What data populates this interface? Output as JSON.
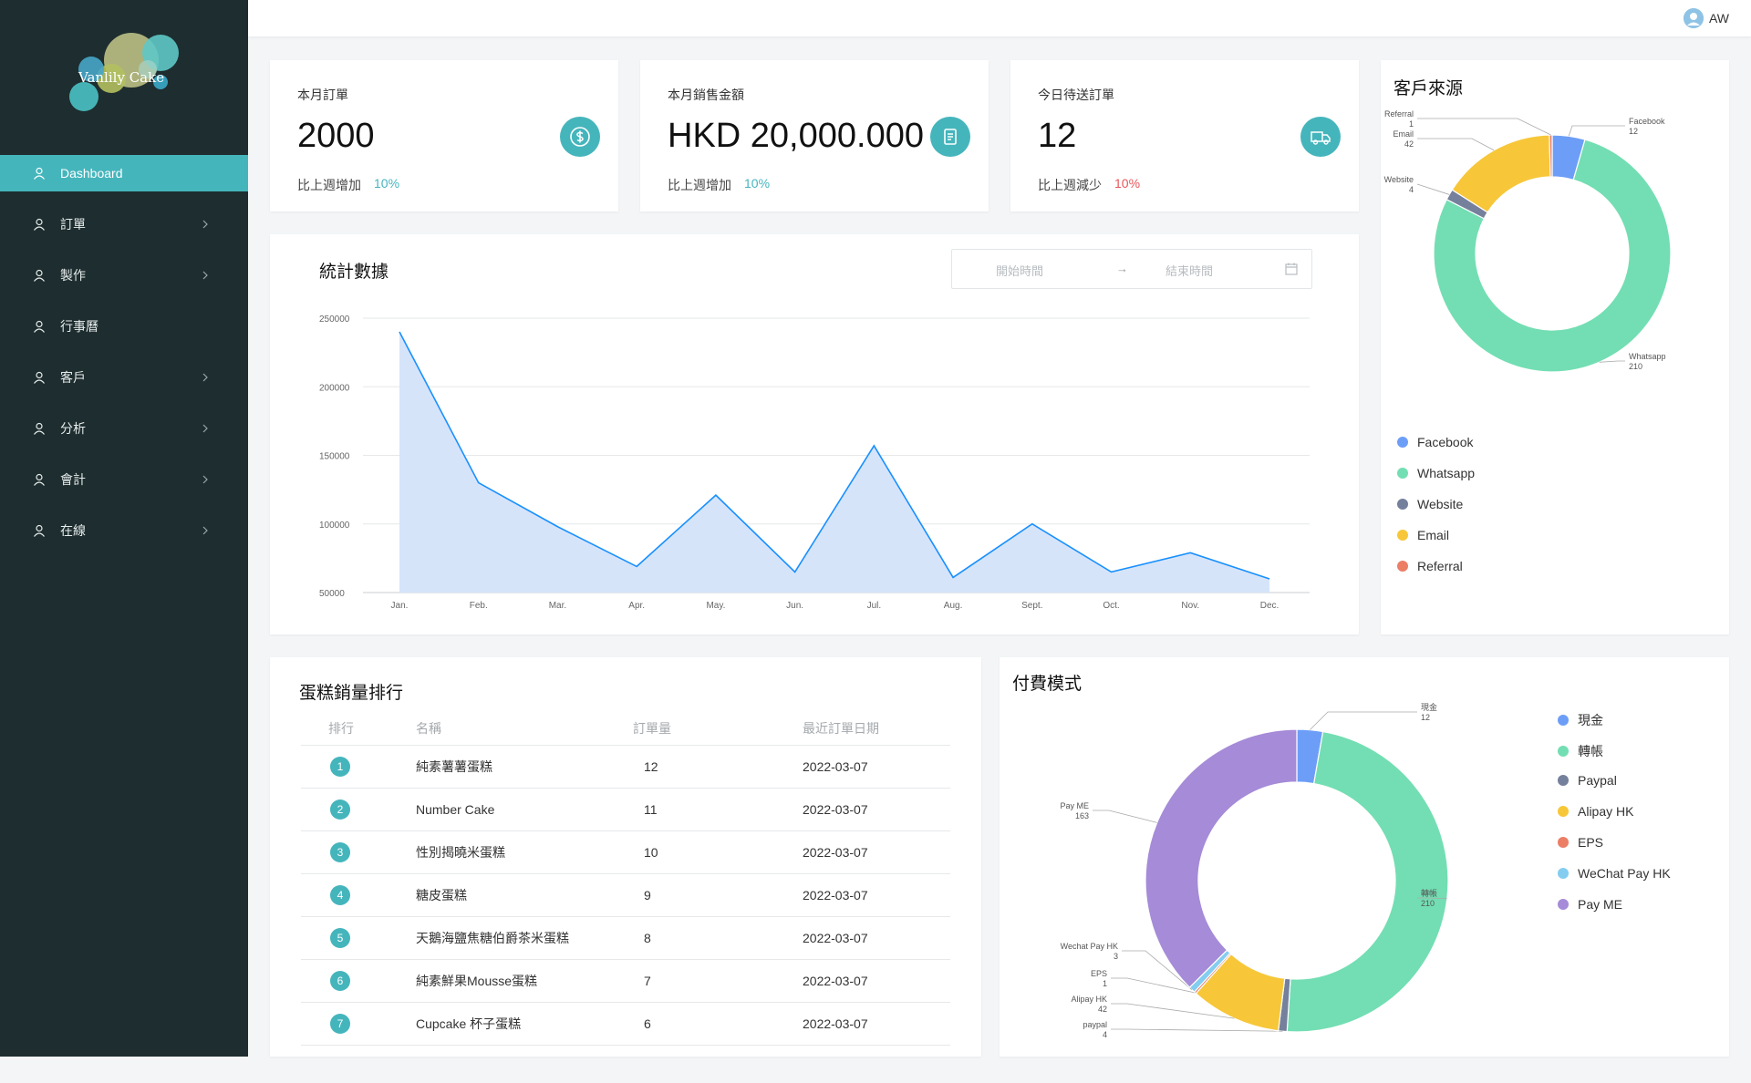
{
  "sidebar": {
    "logo_text": "Vanlily Cake",
    "items": [
      {
        "label": "Dashboard",
        "active": true,
        "has_children": false
      },
      {
        "label": "訂單",
        "has_children": true
      },
      {
        "label": "製作",
        "has_children": true
      },
      {
        "label": "行事曆",
        "has_children": false
      },
      {
        "label": "客戶",
        "has_children": true
      },
      {
        "label": "分析",
        "has_children": true
      },
      {
        "label": "會計",
        "has_children": true
      },
      {
        "label": "在線",
        "has_children": true
      }
    ]
  },
  "header": {
    "user_initials": "AW"
  },
  "stats": [
    {
      "title": "本月訂單",
      "value": "2000",
      "compare": "比上週增加",
      "pct": "10%",
      "trend": "up",
      "icon": "dollar-icon"
    },
    {
      "title": "本月銷售金額",
      "value": "HKD 20,000.000",
      "compare": "比上週增加",
      "pct": "10%",
      "trend": "up",
      "icon": "document-icon"
    },
    {
      "title": "今日待送訂單",
      "value": "12",
      "compare": "比上週減少",
      "pct": "10%",
      "trend": "down",
      "icon": "truck-icon"
    }
  ],
  "colors": {
    "accent": "#45b5bc",
    "up": "#45b5bc",
    "down": "#e8565a"
  },
  "stats_chart": {
    "title": "統計數據",
    "date_range": {
      "start_placeholder": "開始時間",
      "end_placeholder": "結束時間",
      "separator": "→"
    },
    "chart_data": {
      "type": "area",
      "categories": [
        "Jan.",
        "Feb.",
        "Mar.",
        "Apr.",
        "May.",
        "Jun.",
        "Jul.",
        "Aug.",
        "Sept.",
        "Oct.",
        "Nov.",
        "Dec."
      ],
      "values": [
        240000,
        130000,
        98000,
        69000,
        121000,
        65000,
        157000,
        61000,
        100000,
        65000,
        79000,
        60000
      ],
      "y_ticks": [
        "250000",
        "200000",
        "150000",
        "100000",
        "50000"
      ],
      "ylim": [
        50000,
        250000
      ],
      "grid": true,
      "line_color": "#1890ff",
      "fill_color": "#d6e4fa"
    }
  },
  "customer_source": {
    "title": "客戶來源",
    "chart_data": {
      "type": "pie",
      "variant": "donut",
      "slices": [
        {
          "name": "Facebook",
          "value": 12,
          "color": "#6d9ef7"
        },
        {
          "name": "Whatsapp",
          "value": 210,
          "color": "#73deb3"
        },
        {
          "name": "Website",
          "value": 4,
          "color": "#75809c"
        },
        {
          "name": "Email",
          "value": 42,
          "color": "#f7c739"
        },
        {
          "name": "Referral",
          "value": 1,
          "color": "#eb7e65"
        }
      ]
    }
  },
  "ranking": {
    "title": "蛋糕銷量排行",
    "columns": [
      "排行",
      "名稱",
      "訂單量",
      "最近訂單日期"
    ],
    "rows": [
      {
        "rank": "1",
        "name": "純素薯薯蛋糕",
        "orders": "12",
        "date": "2022-03-07"
      },
      {
        "rank": "2",
        "name": "Number Cake",
        "orders": "11",
        "date": "2022-03-07"
      },
      {
        "rank": "3",
        "name": "性別揭曉米蛋糕",
        "orders": "10",
        "date": "2022-03-07"
      },
      {
        "rank": "4",
        "name": "糖皮蛋糕",
        "orders": "9",
        "date": "2022-03-07"
      },
      {
        "rank": "5",
        "name": "天鵝海鹽焦糖伯爵茶米蛋糕",
        "orders": "8",
        "date": "2022-03-07"
      },
      {
        "rank": "6",
        "name": "純素鮮果Mousse蛋糕",
        "orders": "7",
        "date": "2022-03-07"
      },
      {
        "rank": "7",
        "name": "Cupcake 杯子蛋糕",
        "orders": "6",
        "date": "2022-03-07"
      }
    ]
  },
  "payment": {
    "title": "付費模式",
    "chart_data": {
      "type": "pie",
      "variant": "donut",
      "slices": [
        {
          "name": "現金",
          "value": 12,
          "color": "#6d9ef7",
          "label_name": "現金"
        },
        {
          "name": "轉帳",
          "value": 210,
          "color": "#73deb3",
          "label_name": "轉帳"
        },
        {
          "name": "Paypal",
          "value": 4,
          "color": "#75809c",
          "label_name": "paypal"
        },
        {
          "name": "Alipay HK",
          "value": 42,
          "color": "#f7c739",
          "label_name": "Alipay HK"
        },
        {
          "name": "EPS",
          "value": 1,
          "color": "#eb7e65",
          "label_name": "EPS"
        },
        {
          "name": "WeChat Pay HK",
          "value": 3,
          "color": "#84cdf0",
          "label_name": "Wechat Pay HK"
        },
        {
          "name": "Pay ME",
          "value": 163,
          "color": "#a58bd8",
          "label_name": "Pay ME"
        }
      ]
    }
  }
}
